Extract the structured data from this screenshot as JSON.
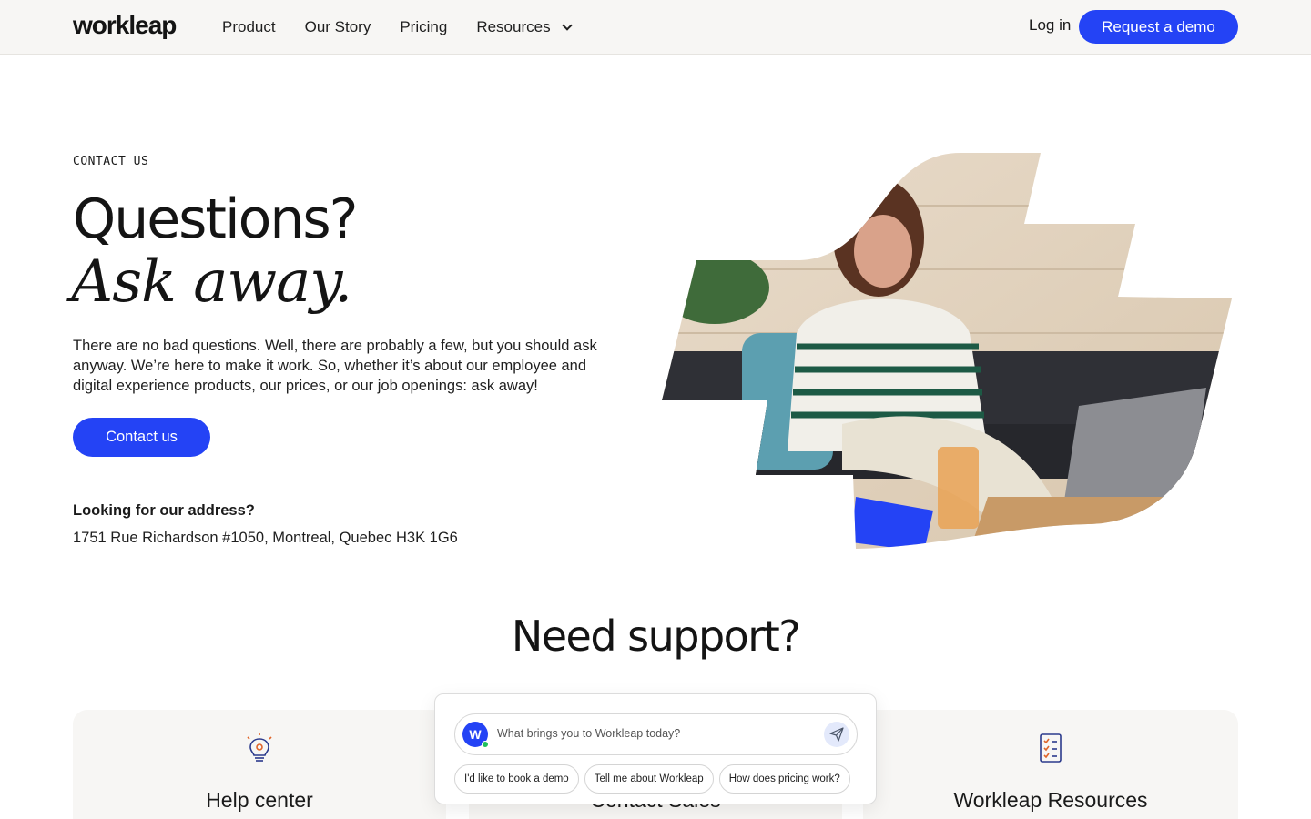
{
  "nav": {
    "logo": "workleap",
    "links": [
      "Product",
      "Our Story",
      "Pricing",
      "Resources"
    ],
    "login": "Log in",
    "demo": "Request a demo"
  },
  "hero": {
    "eyebrow": "CONTACT US",
    "title_line1": "Questions?",
    "title_line2": "Ask away.",
    "lead": "There are no bad questions. Well, there are probably a few, but you should ask anyway. We’re here to make it work. So, whether it’s about our employee and digital experience products, our prices, or our job openings: ask away!",
    "cta": "Contact us",
    "address_heading": "Looking for our address?",
    "address": "1751 Rue Richardson #1050, Montreal, Quebec H3K 1G6"
  },
  "support": {
    "title": "Need support?",
    "cards": [
      {
        "title": "Help center",
        "icon": "lightbulb-icon"
      },
      {
        "title": "Contact Sales",
        "icon": "chat-icon"
      },
      {
        "title": "Workleap Resources",
        "icon": "checklist-icon"
      }
    ]
  },
  "chat": {
    "avatar_letter": "W",
    "placeholder": "What brings you to Workleap today?",
    "chips": [
      "I'd like to book a demo",
      "Tell me about Workleap",
      "How does pricing work?"
    ]
  },
  "colors": {
    "accent": "#2443f5",
    "nav_bg": "#f7f6f4",
    "card_bg": "#f7f6f4"
  }
}
